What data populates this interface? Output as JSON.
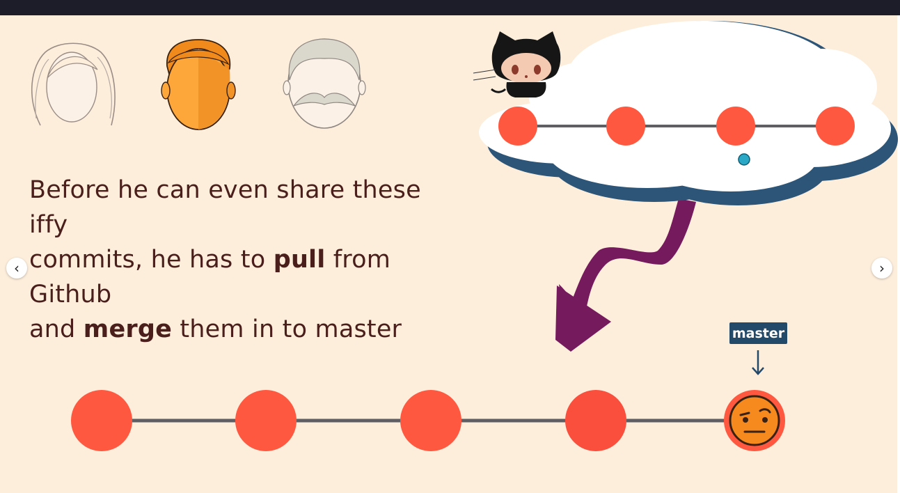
{
  "caption": {
    "line1": "Before he can even share these iffy",
    "line2_pre": "commits, he has to ",
    "line2_bold": "pull",
    "line2_post": " from Github",
    "line3_pre": "and ",
    "line3_bold": "merge",
    "line3_post": " them in to master"
  },
  "branch_label": "master",
  "nav": {
    "prev_icon": "‹",
    "next_icon": "›"
  },
  "colors": {
    "background": "#FDEEDC",
    "commit": "#FF5840",
    "arrow": "#751A5C",
    "cloud_shadow": "#2C5578",
    "tag": "#244A6A",
    "text": "#4A1F1B"
  },
  "icons": [
    "woman-face-icon",
    "man-face-icon",
    "old-man-face-icon",
    "octocat-icon",
    "cloud-icon",
    "curved-arrow-icon",
    "down-arrow-icon",
    "suspicious-emoji-icon"
  ],
  "remote_commits": 4,
  "local_commits": 5
}
